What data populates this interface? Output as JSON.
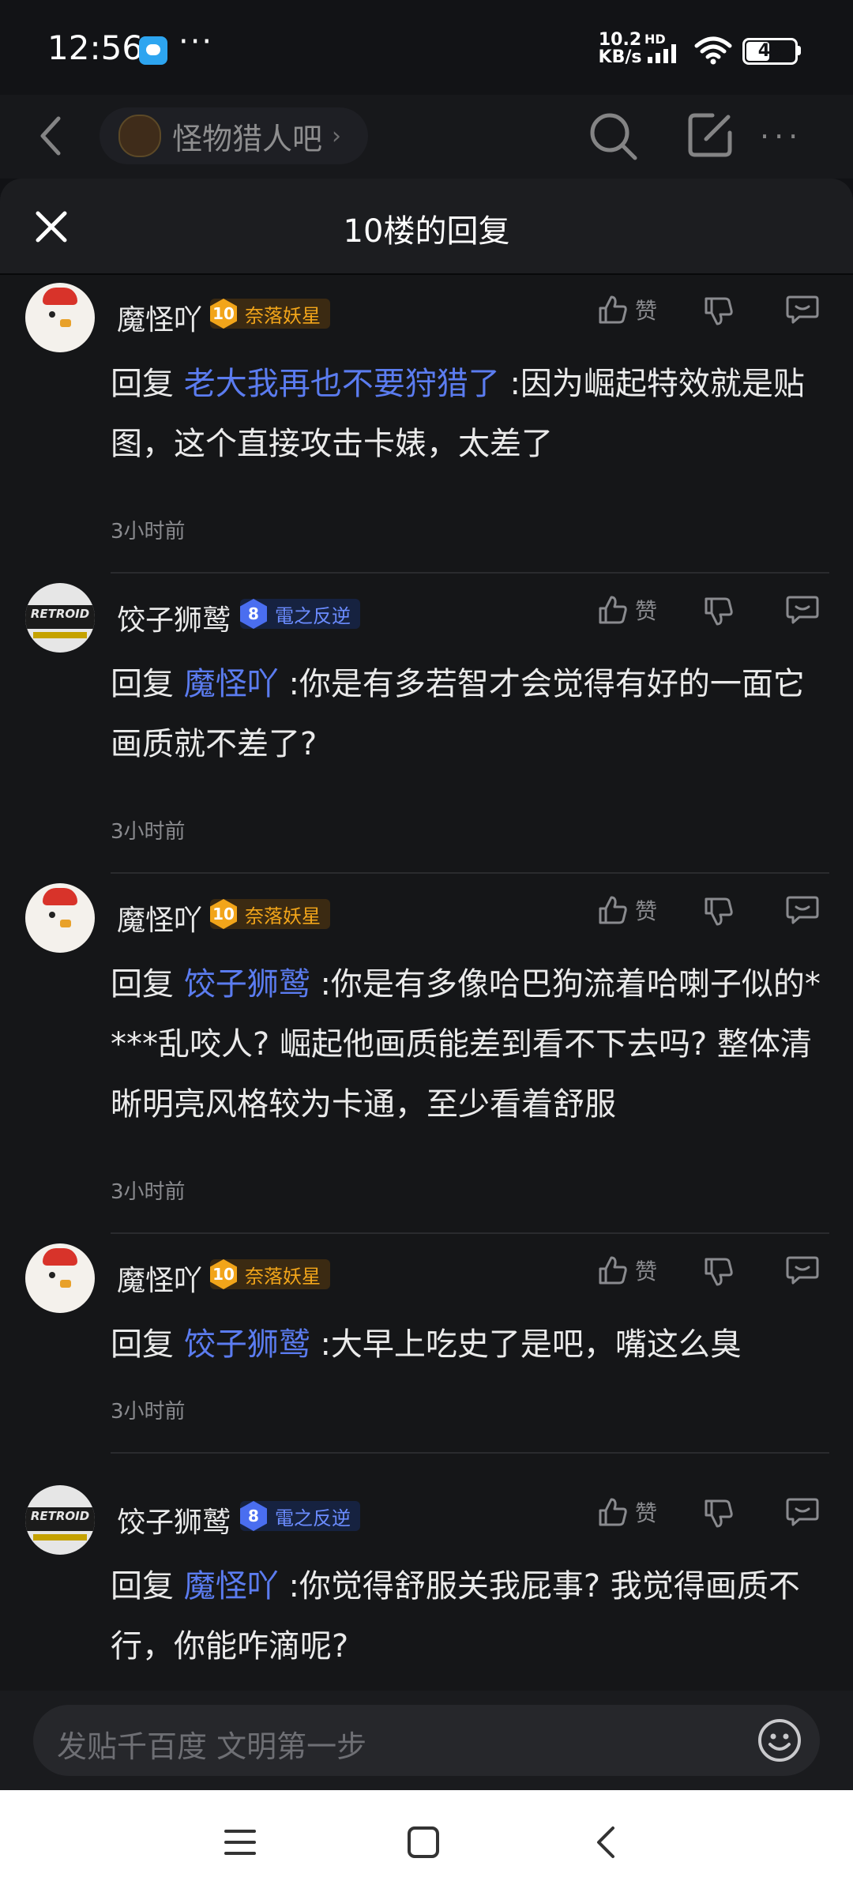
{
  "status_bar": {
    "time": "12:56",
    "net_speed_value": "10.2",
    "net_speed_unit": "KB/s",
    "hd_label": "HD",
    "battery_level": "46",
    "battery_fraction": 0.46
  },
  "nav": {
    "forum_name": "怪物猎人吧"
  },
  "sheet": {
    "title": "10楼的回复",
    "input_placeholder": "发贴千百度 文明第一步"
  },
  "replies": [
    {
      "username": "魔怪吖",
      "level": "10",
      "badge_text": "奈落妖星",
      "like_label": "赞",
      "reply_prefix": "回复",
      "mention": "老大我再也不要狩猎了",
      "text": ":因为崛起特效就是贴图，这个直接攻击卡婊，太差了",
      "time": "3小时前"
    },
    {
      "username": "饺子狮鹫",
      "level": "8",
      "badge_text": "電之反逆",
      "like_label": "赞",
      "reply_prefix": "回复",
      "mention": "魔怪吖",
      "text": ":你是有多若智才会觉得有好的一面它画质就不差了?",
      "time": "3小时前"
    },
    {
      "username": "魔怪吖",
      "level": "10",
      "badge_text": "奈落妖星",
      "like_label": "赞",
      "reply_prefix": "回复",
      "mention": "饺子狮鹫",
      "text": ":你是有多像哈巴狗流着哈喇子似的****乱咬人? 崛起他画质能差到看不下去吗? 整体清晰明亮风格较为卡通，至少看着舒服",
      "time": "3小时前"
    },
    {
      "username": "魔怪吖",
      "level": "10",
      "badge_text": "奈落妖星",
      "like_label": "赞",
      "reply_prefix": "回复",
      "mention": "饺子狮鹫",
      "text": ":大早上吃史了是吧，嘴这么臭",
      "time": "3小时前"
    },
    {
      "username": "饺子狮鹫",
      "level": "8",
      "badge_text": "電之反逆",
      "like_label": "赞",
      "reply_prefix": "回复",
      "mention": "魔怪吖",
      "text": ":你觉得舒服关我屁事? 我觉得画质不行，你能咋滴呢?",
      "time": ""
    }
  ],
  "colors": {
    "background": "#111215",
    "sheet": "#151618",
    "mention": "#5b7cf0",
    "badge_orange": "#f2a51a",
    "badge_blue": "#6b8cff"
  }
}
